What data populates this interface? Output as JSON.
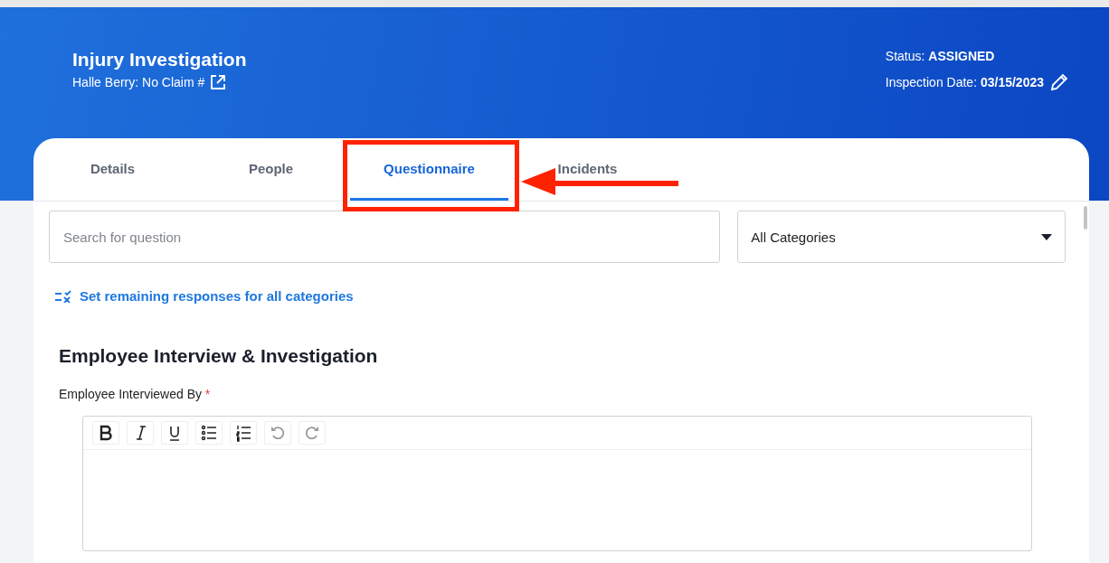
{
  "header": {
    "title": "Injury Investigation",
    "subtitle": "Halle Berry: No Claim #",
    "status_label": "Status:",
    "status_value": "ASSIGNED",
    "date_label": "Inspection Date:",
    "date_value": "03/15/2023"
  },
  "tabs": [
    {
      "label": "Details",
      "selected": false
    },
    {
      "label": "People",
      "selected": false
    },
    {
      "label": "Questionnaire",
      "selected": true
    },
    {
      "label": "Incidents",
      "selected": false
    }
  ],
  "search": {
    "placeholder": "Search for question"
  },
  "category_select": {
    "value": "All Categories"
  },
  "set_responses_link": "Set remaining responses for all categories",
  "section_title": "Employee Interview & Investigation",
  "question": {
    "label": "Employee Interviewed By",
    "required": true,
    "required_mark": "*"
  },
  "editor_toolbar": [
    {
      "kind": "bold",
      "disabled": false
    },
    {
      "kind": "italic",
      "disabled": false
    },
    {
      "kind": "underline",
      "disabled": false
    },
    {
      "kind": "bullets",
      "disabled": false
    },
    {
      "kind": "numbers",
      "disabled": false
    },
    {
      "kind": "undo",
      "disabled": true
    },
    {
      "kind": "redo",
      "disabled": true
    }
  ]
}
